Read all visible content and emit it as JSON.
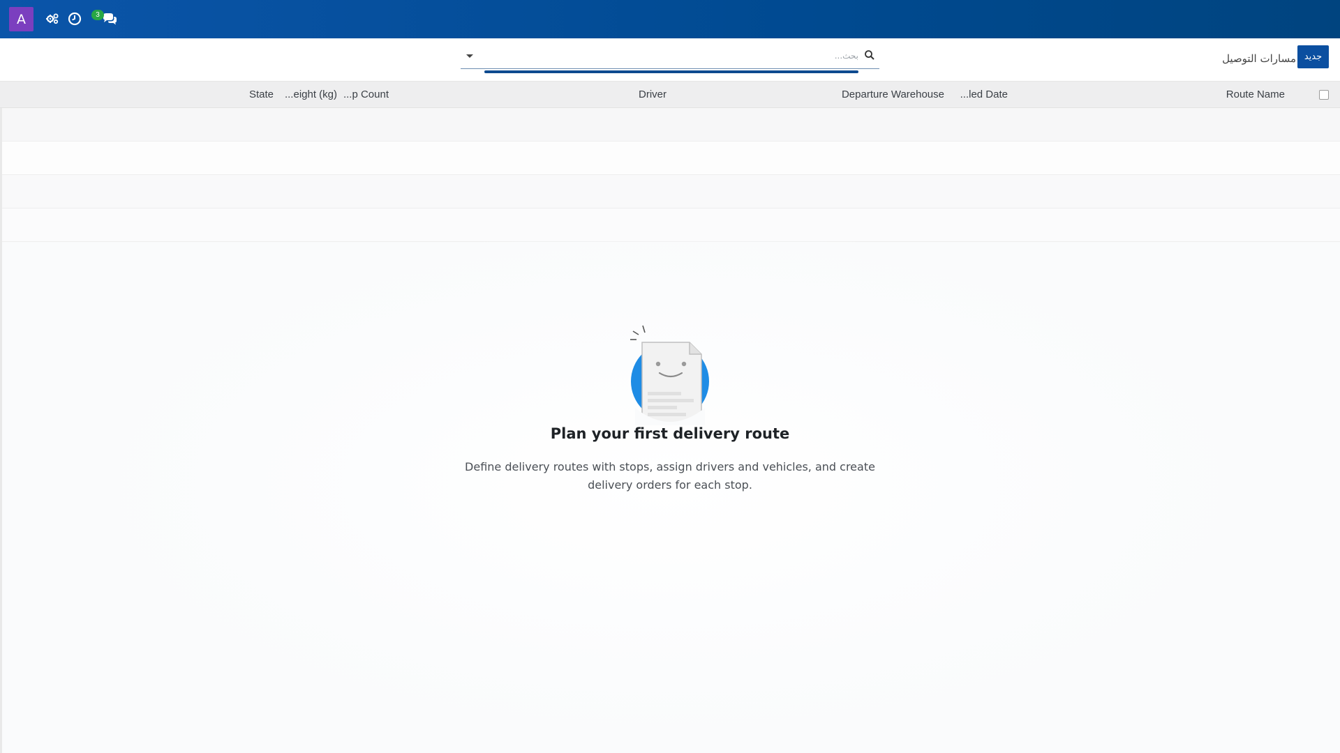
{
  "navbar": {
    "avatar_letter": "A",
    "icons": [
      "cogs-icon",
      "clock-icon",
      "chat-icon"
    ],
    "messages_count": "3",
    "colors": {
      "nav_bg": "#004a91",
      "avatar_bg": "#7b3fbf",
      "badge_bg": "#28a745"
    }
  },
  "control_panel": {
    "new_button_label": "جديد",
    "breadcrumb": "مسارات التوصيل",
    "search": {
      "placeholder": "بحث...",
      "value": ""
    }
  },
  "list": {
    "columns": [
      {
        "key": "route_name",
        "label": "Route Name"
      },
      {
        "key": "scheduled_date",
        "label": "...led Date"
      },
      {
        "key": "departure_warehouse",
        "label": "Departure Warehouse"
      },
      {
        "key": "driver",
        "label": "Driver"
      },
      {
        "key": "stop_count",
        "label": "...p Count"
      },
      {
        "key": "weight",
        "label": "...eight (kg)"
      },
      {
        "key": "state",
        "label": "State"
      }
    ],
    "rows": []
  },
  "helper": {
    "title": "Plan your first delivery route",
    "text": "Define delivery routes with stops, assign drivers and vehicles, and create delivery orders for each stop."
  }
}
